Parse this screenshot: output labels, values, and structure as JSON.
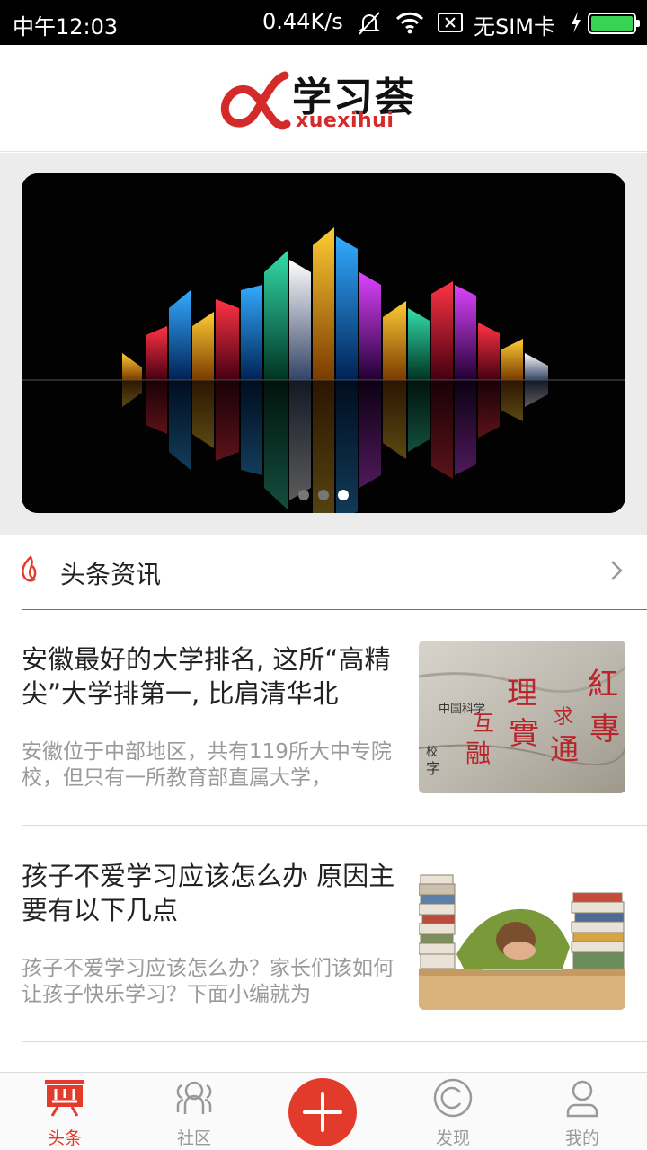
{
  "status_bar": {
    "time": "中午12:03",
    "net_speed": "0.44K/s",
    "sim": "无SIM卡",
    "battery_level": 1.0
  },
  "header": {
    "logo_cn": "学习荟",
    "logo_en": "xuexihui",
    "brand_color": "#d42a2a"
  },
  "banner": {
    "slide_count": 3,
    "active_slide": 3
  },
  "section": {
    "title": "头条资讯",
    "icon": "flame-icon"
  },
  "news": [
    {
      "headline": "安徽最好的大学排名, 这所“高精尖”大学排第一, 比肩清华北",
      "summary": "安徽位于中部地区，共有119所大中专院校，但只有一所教育部直属大学，",
      "image": "calligraphy-stone-image"
    },
    {
      "headline": "孩子不爱学习应该怎么办 原因主要有以下几点",
      "summary": "孩子不爱学习应该怎么办？家长们该如何让孩子快乐学习？下面小编就为",
      "image": "student-sleeping-on-books-image"
    }
  ],
  "tabs": [
    {
      "label": "头条",
      "icon": "headline-icon",
      "active": true
    },
    {
      "label": "社区",
      "icon": "community-icon",
      "active": false
    },
    {
      "label": "",
      "icon": "add-icon",
      "active": false
    },
    {
      "label": "发现",
      "icon": "discover-icon",
      "active": false
    },
    {
      "label": "我的",
      "icon": "profile-icon",
      "active": false
    }
  ],
  "colors": {
    "accent": "#e33b2b",
    "status_bar_bg": "#000000",
    "battery": "#39d353"
  }
}
